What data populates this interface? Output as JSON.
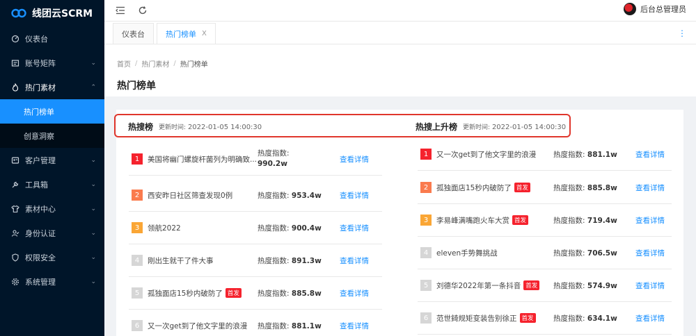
{
  "app": {
    "name": "线团云SCRM"
  },
  "sidebar": {
    "items": [
      {
        "label": "仪表台",
        "icon": "dashboard-icon",
        "arrow": ""
      },
      {
        "label": "账号矩阵",
        "icon": "account-icon",
        "arrow": "⌄"
      },
      {
        "label": "热门素材",
        "icon": "fire-icon",
        "arrow": "⌃"
      },
      {
        "label": "客户管理",
        "icon": "customer-icon",
        "arrow": "⌄"
      },
      {
        "label": "工具箱",
        "icon": "wrench-icon",
        "arrow": "⌄"
      },
      {
        "label": "素材中心",
        "icon": "shirt-icon",
        "arrow": "⌄"
      },
      {
        "label": "身份认证",
        "icon": "identity-icon",
        "arrow": "⌄"
      },
      {
        "label": "权限安全",
        "icon": "shield-icon",
        "arrow": "⌄"
      },
      {
        "label": "系统管理",
        "icon": "gear-icon",
        "arrow": "⌄"
      }
    ],
    "sub_items": [
      {
        "label": "热门榜单",
        "active": true
      },
      {
        "label": "创意洞察",
        "active": false
      }
    ]
  },
  "header": {
    "user": "后台总管理员"
  },
  "tabs": [
    {
      "label": "仪表台",
      "active": false
    },
    {
      "label": "热门榜单",
      "active": true,
      "close": "X"
    }
  ],
  "breadcrumb": [
    "首页",
    "热门素材",
    "热门榜单"
  ],
  "page_title": "热门榜单",
  "hot_search": {
    "title": "热搜榜",
    "time_label": "更新时间:",
    "time_value": "2022-01-05 14:00:30",
    "heat_label": "热度指数:",
    "detail_label": "查看详情",
    "rows": [
      {
        "rank": "1",
        "title": "美国将幽门螺旋杆菌列为明确致...",
        "heat": "990.2w",
        "badge": ""
      },
      {
        "rank": "2",
        "title": "西安昨日社区筛查发现0例",
        "heat": "953.4w",
        "badge": ""
      },
      {
        "rank": "3",
        "title": "领航2022",
        "heat": "900.4w",
        "badge": ""
      },
      {
        "rank": "4",
        "title": "刚出生就干了件大事",
        "heat": "891.3w",
        "badge": ""
      },
      {
        "rank": "5",
        "title": "孤独面店15秒内破防了",
        "heat": "885.8w",
        "badge": "首发"
      },
      {
        "rank": "6",
        "title": "又一次get到了他文字里的浪漫",
        "heat": "881.1w",
        "badge": ""
      }
    ]
  },
  "hot_rising": {
    "title": "热搜上升榜",
    "time_label": "更新时间:",
    "time_value": "2022-01-05 14:00:30",
    "heat_label": "热度指数:",
    "detail_label": "查看详情",
    "rows": [
      {
        "rank": "1",
        "title": "又一次get到了他文字里的浪漫",
        "heat": "881.1w",
        "badge": ""
      },
      {
        "rank": "2",
        "title": "孤独面店15秒内破防了",
        "heat": "885.8w",
        "badge": "首发"
      },
      {
        "rank": "3",
        "title": "李易峰满嘴跑火车大赏",
        "heat": "719.4w",
        "badge": "首发"
      },
      {
        "rank": "4",
        "title": "eleven手势舞挑战",
        "heat": "706.5w",
        "badge": ""
      },
      {
        "rank": "5",
        "title": "刘德华2022年第一条抖音",
        "heat": "574.9w",
        "badge": "首发"
      },
      {
        "rank": "6",
        "title": "范世錡规矩变装告别徐正",
        "heat": "634.1w",
        "badge": "首发"
      }
    ]
  }
}
